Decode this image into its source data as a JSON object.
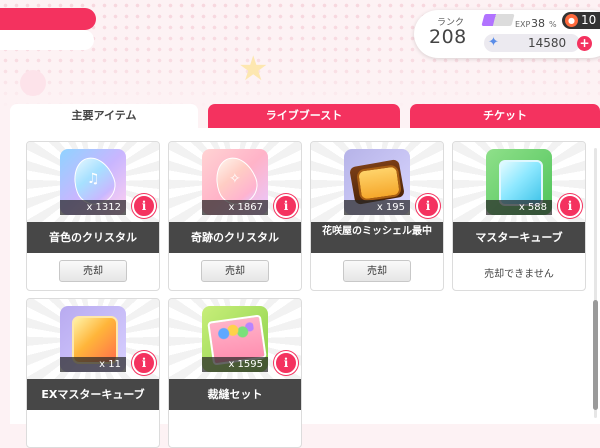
{
  "player": {
    "rank_label": "ランク",
    "rank_value": "208",
    "exp_label": "EXP",
    "exp_value": "38",
    "exp_unit": "%",
    "exp_fraction": 0.38,
    "coins": "10",
    "gems": "14580"
  },
  "tabs": [
    {
      "label": "主要アイテム",
      "active": true
    },
    {
      "label": "ライブブースト",
      "active": false
    },
    {
      "label": "チケット",
      "active": false
    }
  ],
  "items": [
    {
      "name": "音色のクリスタル",
      "count": "x 1312",
      "action": "売却",
      "icon": "blue-crystal-icon"
    },
    {
      "name": "奇跡のクリスタル",
      "count": "x 1867",
      "action": "売却",
      "icon": "pink-crystal-icon"
    },
    {
      "name": "花咲屋のミッシェル最中",
      "count": "x 195",
      "action": "売却",
      "icon": "monaka-icon"
    },
    {
      "name": "マスターキューブ",
      "count": "x 588",
      "action": "売却できません",
      "icon": "master-cube-icon"
    },
    {
      "name": "EXマスターキューブ",
      "count": "x 11",
      "icon": "ex-master-cube-icon"
    },
    {
      "name": "裁縫セット",
      "count": "x 1595",
      "icon": "sewing-set-icon"
    }
  ],
  "info_label": "i",
  "colors": {
    "accent": "#f4325f",
    "name_bar": "#474747",
    "exp_bar": "#b173ff"
  }
}
